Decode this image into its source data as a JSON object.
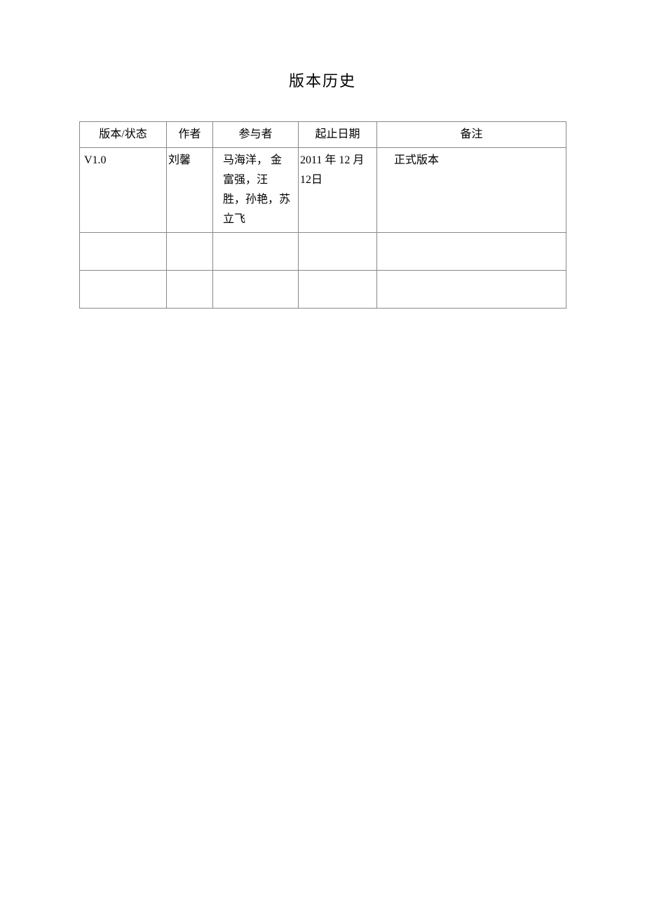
{
  "title": "版本历史",
  "table": {
    "headers": {
      "version_status": "版本/状态",
      "author": "作者",
      "participants": "参与者",
      "dates": "起止日期",
      "notes": "备注"
    },
    "rows": [
      {
        "version_status": "V1.0",
        "author": "刘馨",
        "participants": "马海洋， 金富强，汪 胜，孙艳，苏立飞",
        "dates": "2011 年 12 月12日",
        "notes": "正式版本"
      },
      {
        "version_status": "",
        "author": "",
        "participants": "",
        "dates": "",
        "notes": ""
      },
      {
        "version_status": "",
        "author": "",
        "participants": "",
        "dates": "",
        "notes": ""
      }
    ]
  }
}
